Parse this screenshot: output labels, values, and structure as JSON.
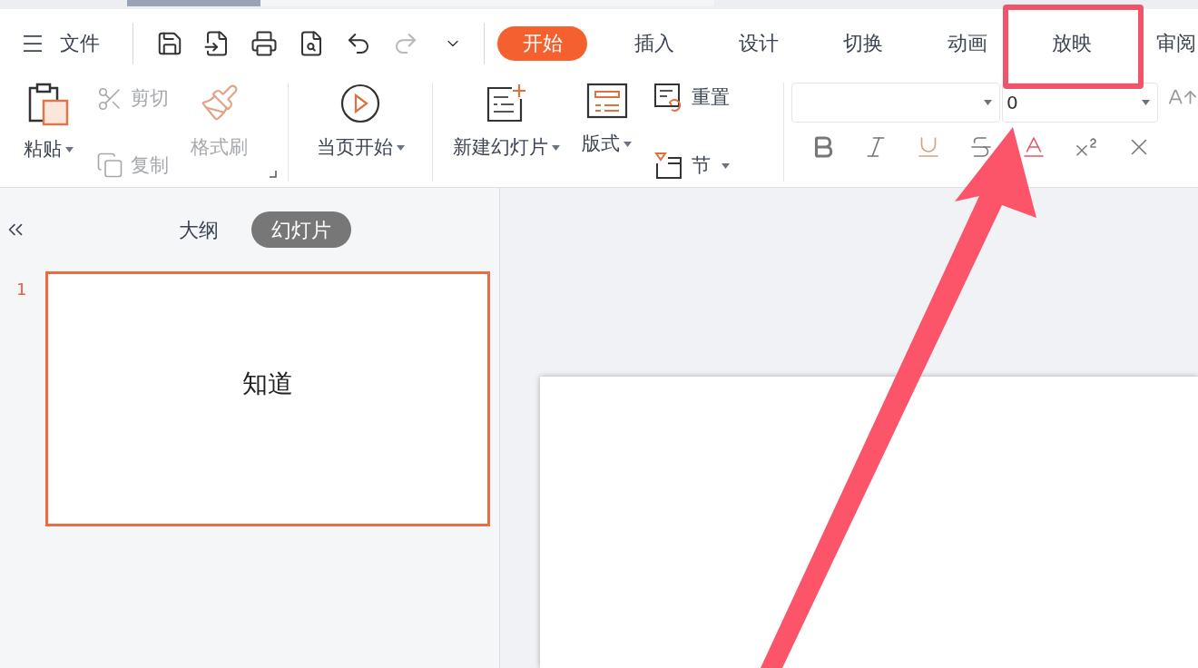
{
  "menu": {
    "label": "文件"
  },
  "quick_tools": [
    {
      "kind": "save",
      "disabled": false
    },
    {
      "kind": "import",
      "disabled": false
    },
    {
      "kind": "print",
      "disabled": false
    },
    {
      "kind": "preview",
      "disabled": false
    },
    {
      "kind": "undo",
      "disabled": false
    },
    {
      "kind": "redo",
      "disabled": true
    },
    {
      "kind": "more",
      "disabled": false
    }
  ],
  "tabs": [
    {
      "label": "开始",
      "selected": true
    },
    {
      "label": "插入",
      "selected": false
    },
    {
      "label": "设计",
      "selected": false
    },
    {
      "label": "切换",
      "selected": false
    },
    {
      "label": "动画",
      "selected": false
    },
    {
      "label": "放映",
      "selected": false
    },
    {
      "label": "审阅",
      "selected": false
    }
  ],
  "clipboard": {
    "paste": {
      "label": "粘贴",
      "disabled": false
    },
    "cut": {
      "label": "剪切",
      "disabled": true
    },
    "copy": {
      "label": "复制",
      "disabled": true
    },
    "painter": {
      "label": "格式刷",
      "disabled": true
    }
  },
  "slideshow": {
    "label": "当页开始"
  },
  "slides_group": {
    "new_slide": {
      "label": "新建幻灯片"
    },
    "layout": {
      "label": "版式"
    },
    "reset": {
      "label": "重置"
    },
    "section": {
      "label": "节"
    }
  },
  "font": {
    "size_value": "0"
  },
  "panel": {
    "tabs": [
      {
        "label": "大纲",
        "selected": false
      },
      {
        "label": "幻灯片",
        "selected": true
      }
    ],
    "slides": [
      {
        "number": "1",
        "text": "知道",
        "selected": true
      }
    ]
  }
}
